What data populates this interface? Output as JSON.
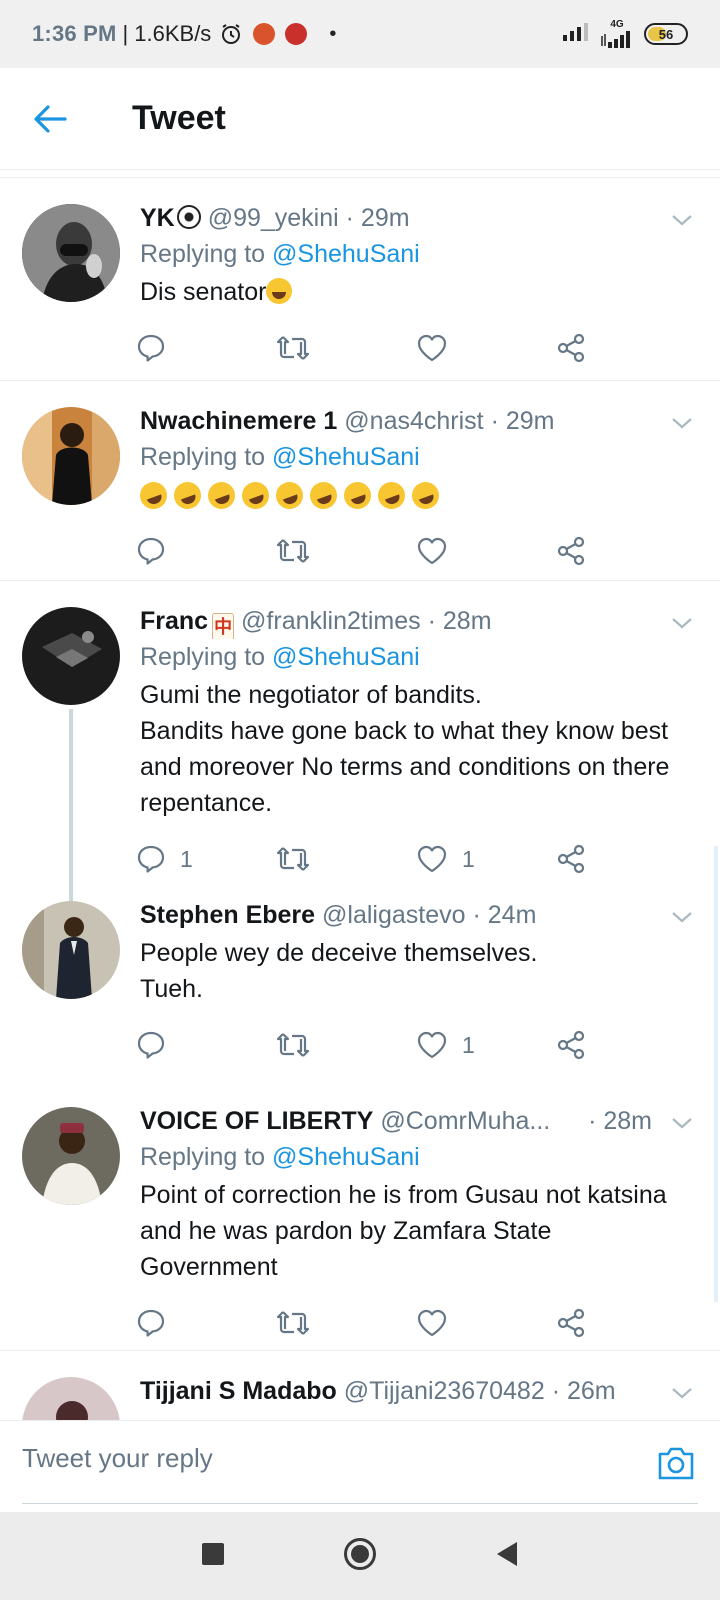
{
  "status_bar": {
    "time": "1:36 PM",
    "network_speed": "1.6KB/s",
    "network_type": "4G",
    "battery": "56",
    "battery_level_percent": 56,
    "icons": [
      "alarm-icon",
      "app-notification-icon",
      "app-notification-icon",
      "dot-icon",
      "signal-icon",
      "signal-4g-icon",
      "battery-icon"
    ]
  },
  "header": {
    "title": "Tweet",
    "back_icon": "arrow-left-icon"
  },
  "colors": {
    "accent": "#1b95e0",
    "secondary_text": "#657786",
    "divider": "#e6ecf0",
    "navbar_bg": "#ececec",
    "statusbar_bg": "#f0f0f0"
  },
  "tweets": [
    {
      "name": "YK",
      "handle": "@99_yekini",
      "time": "· 29m",
      "replying_prefix": "Replying to",
      "replying_to": "@ShehuSani",
      "body": "Dis senator",
      "reply_count": "",
      "retweet_count": "",
      "like_count": ""
    },
    {
      "name": "Nwachinemere 1",
      "handle": "@nas4christ",
      "time": "· 29m",
      "replying_prefix": "Replying to",
      "replying_to": "@ShehuSani",
      "body": "",
      "emoji_count": 9,
      "reply_count": "",
      "retweet_count": "",
      "like_count": ""
    },
    {
      "name": "Franc",
      "handle": "@franklin2times",
      "time": "· 28m",
      "replying_prefix": "Replying to",
      "replying_to": "@ShehuSani",
      "body": "Gumi the negotiator of bandits.\nBandits have gone back to what they know best and moreover No terms and conditions on there repentance.",
      "reply_count": "1",
      "retweet_count": "",
      "like_count": "1"
    },
    {
      "name": "Stephen Ebere",
      "handle": "@laligastevo",
      "time": "· 24m",
      "body": "People wey de deceive themselves.\nTueh.",
      "reply_count": "",
      "retweet_count": "",
      "like_count": "1"
    },
    {
      "name": "VOICE OF LIBERTY",
      "handle": "@ComrMuha...",
      "time": "· 28m",
      "replying_prefix": "Replying to",
      "replying_to": "@ShehuSani",
      "body": "Point of correction he is from Gusau not katsina and he was pardon by Zamfara State Government",
      "reply_count": "",
      "retweet_count": "",
      "like_count": ""
    },
    {
      "name": "Tijjani S Madabo",
      "handle": "@Tijjani23670482",
      "time": "· 26m"
    }
  ],
  "composer": {
    "placeholder": "Tweet your reply",
    "camera_icon": "camera-icon"
  },
  "nav_bar": {
    "icons": [
      "recents-square-icon",
      "home-circle-icon",
      "back-triangle-icon"
    ]
  }
}
